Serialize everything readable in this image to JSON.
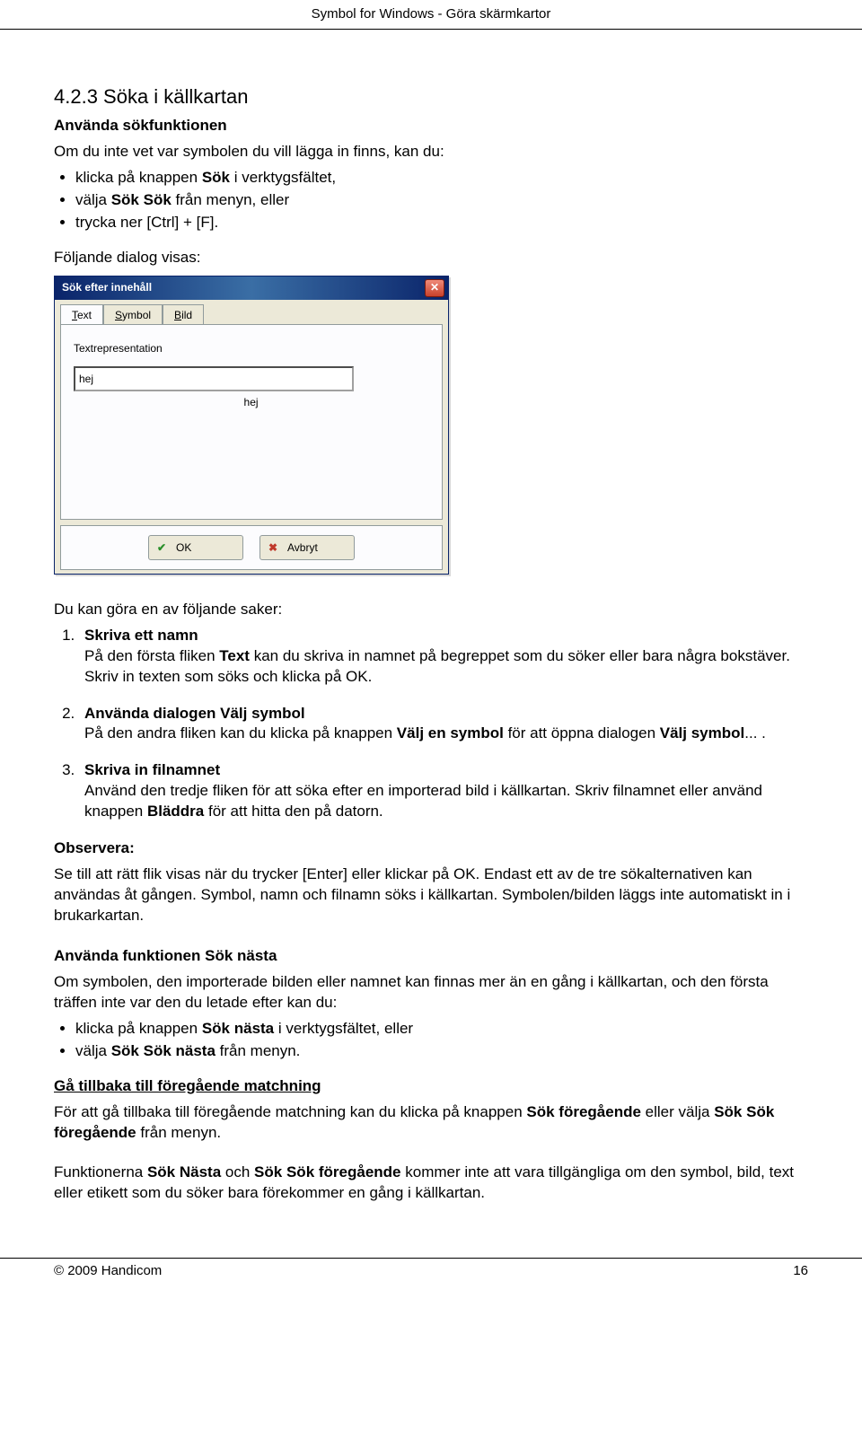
{
  "header": "Symbol for Windows - Göra skärmkartor",
  "h3": "4.2.3  Söka i källkartan",
  "sub1_title": "Använda sökfunktionen",
  "sub1_intro": "Om du inte vet var symbolen du vill lägga in finns, kan du:",
  "sub1_bullets": [
    {
      "pre": "klicka på knappen ",
      "b": "Sök",
      "post": " i verktygsfältet,"
    },
    {
      "pre": "välja ",
      "b": "Sök",
      "post_between": " ",
      "b2": "Sök",
      "post": " från menyn, eller"
    },
    {
      "pre": "trycka ner [Ctrl] + [F].",
      "b": "",
      "post": ""
    }
  ],
  "sub1_after": "Följande dialog visas:",
  "dialog": {
    "title": "Sök efter innehåll",
    "tabs": [
      "Text",
      "Symbol",
      "Bild"
    ],
    "field_label": "Textrepresentation",
    "input_value": "hej",
    "preview": "hej",
    "ok": "OK",
    "cancel": "Avbryt"
  },
  "afterdialog_intro": "Du kan göra en av följande saker:",
  "numlist": [
    {
      "title": "Skriva ett namn",
      "body_parts": [
        {
          "t": "På den första fliken "
        },
        {
          "b": "Text"
        },
        {
          "t": " kan du skriva in namnet på begreppet som du söker eller bara några bokstäver. Skriv in texten som söks och klicka på OK."
        }
      ]
    },
    {
      "title": "Använda dialogen Välj symbol",
      "body_parts": [
        {
          "t": "På den andra fliken kan du klicka på knappen "
        },
        {
          "b": "Välj en symbol"
        },
        {
          "t": " för att öppna dialogen "
        },
        {
          "b": "Välj symbol"
        },
        {
          "t": "... ."
        }
      ]
    },
    {
      "title": "Skriva in filnamnet",
      "body_parts": [
        {
          "t": "Använd den tredje fliken för att söka efter en importerad bild i källkartan. Skriv filnamnet eller använd knappen "
        },
        {
          "b": "Bläddra"
        },
        {
          "t": " för att hitta den på datorn."
        }
      ]
    }
  ],
  "obs_label": "Observera:",
  "obs_body": "Se till att rätt flik visas när du trycker [Enter] eller klickar på OK. Endast ett av de tre sökalternativen kan användas åt gången. Symbol, namn och filnamn söks i källkartan. Symbolen/bilden läggs inte automatiskt in i brukarkartan.",
  "sub2_title": "Använda funktionen Sök nästa",
  "sub2_intro": "Om symbolen, den importerade bilden eller namnet kan finnas mer än en gång i källkartan, och den första träffen inte var den du letade efter kan du:",
  "sub2_bullets": [
    {
      "parts": [
        {
          "t": "klicka på knappen "
        },
        {
          "b": "Sök nästa"
        },
        {
          "t": " i verktygsfältet, eller"
        }
      ]
    },
    {
      "parts": [
        {
          "t": "välja "
        },
        {
          "b": "Sök"
        },
        {
          "t": " "
        },
        {
          "b": "Sök nästa"
        },
        {
          "t": " från menyn."
        }
      ]
    }
  ],
  "sub3_title": "Gå tillbaka till föregående matchning",
  "sub3_body_parts": [
    {
      "t": "För att gå tillbaka till föregående matchning kan du klicka på knappen "
    },
    {
      "b": "Sök föregående"
    },
    {
      "t": " eller välja "
    },
    {
      "b": "Sök"
    },
    {
      "t": " "
    },
    {
      "b": "Sök föregående"
    },
    {
      "t": " från menyn."
    }
  ],
  "final_parts": [
    {
      "t": "Funktionerna  "
    },
    {
      "b": "Sök"
    },
    {
      "t": " "
    },
    {
      "b": "Nästa"
    },
    {
      "t": " och "
    },
    {
      "b": "Sök"
    },
    {
      "t": " "
    },
    {
      "b": "Sök föregående"
    },
    {
      "t": " kommer inte att vara tillgängliga om den symbol, bild, text eller etikett som du söker bara förekommer en gång i källkartan."
    }
  ],
  "footer_left": "© 2009 Handicom",
  "footer_right": "16"
}
